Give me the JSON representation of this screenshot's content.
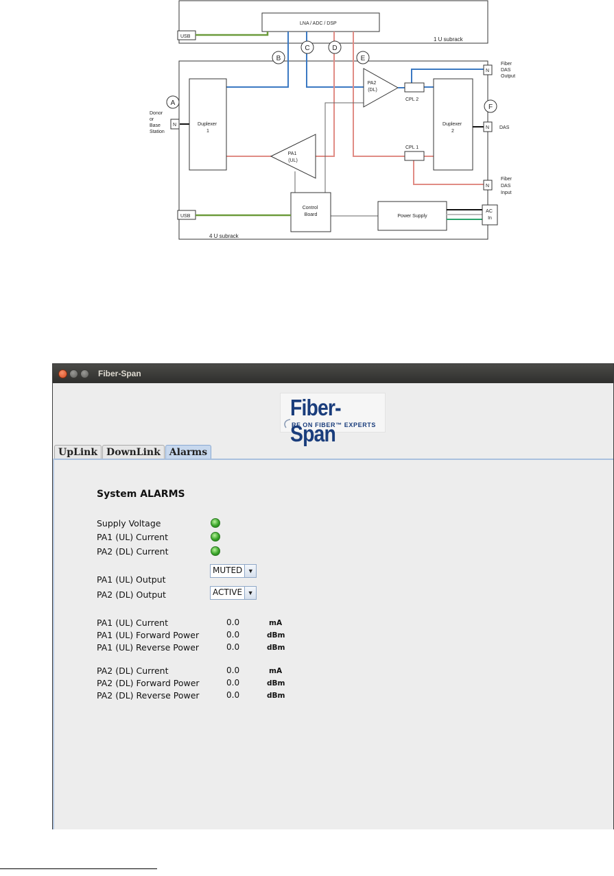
{
  "diagram": {
    "subrack_1u": "1 U subrack",
    "subrack_4u": "4 U subrack",
    "lna_block": "LNA / ADC / DSP",
    "usb_top": "USB",
    "usb_bottom": "USB",
    "markers": [
      "A",
      "B",
      "C",
      "D",
      "E",
      "F"
    ],
    "donor_label": [
      "Donor",
      "or",
      "Base",
      "Station"
    ],
    "n_connector": "N",
    "duplexer1": [
      "Duplexer",
      "1"
    ],
    "duplexer2": [
      "Duplexer",
      "2"
    ],
    "pa1": [
      "PA1",
      "(UL)"
    ],
    "pa2": [
      "PA2",
      "(DL)"
    ],
    "cpl1": "CPL 1",
    "cpl2": "CPL 2",
    "control_board": [
      "Control",
      "Board"
    ],
    "power_supply": "Power Supply",
    "ac_in": [
      "AC",
      "In"
    ],
    "fiber_das_output": [
      "Fiber",
      "DAS",
      "Output"
    ],
    "das": "DAS",
    "fiber_das_input": [
      "Fiber",
      "DAS",
      "Input"
    ],
    "colors": {
      "blue": "#3a78c2",
      "red": "#e08b84",
      "green": "#6b9a3a",
      "black": "#111111"
    }
  },
  "window": {
    "title": "Fiber-Span",
    "logo": {
      "main": "Fiber-Span",
      "tagline": "RF ON FIBER™ EXPERTS"
    },
    "tabs": [
      "UpLink",
      "DownLink",
      "Alarms"
    ],
    "active_tab": "Alarms",
    "heading": "System ALARMS",
    "indicators": [
      {
        "label": "Supply Voltage",
        "status": "ok"
      },
      {
        "label": "PA1 (UL) Current",
        "status": "ok"
      },
      {
        "label": "PA2 (DL) Current",
        "status": "ok"
      }
    ],
    "outputs": [
      {
        "label": "PA1 (UL) Output",
        "value": "MUTED"
      },
      {
        "label": "PA2 (DL) Output",
        "value": "ACTIVE"
      }
    ],
    "measurements_pa1": [
      {
        "label": "PA1 (UL) Current",
        "value": "0.0",
        "unit": "mA"
      },
      {
        "label": "PA1 (UL) Forward Power",
        "value": "0.0",
        "unit": "dBm"
      },
      {
        "label": "PA1 (UL) Reverse Power",
        "value": "0.0",
        "unit": "dBm"
      }
    ],
    "measurements_pa2": [
      {
        "label": "PA2 (DL) Current",
        "value": "0.0",
        "unit": "mA"
      },
      {
        "label": "PA2 (DL) Forward Power",
        "value": "0.0",
        "unit": "dBm"
      },
      {
        "label": "PA2 (DL) Reverse Power",
        "value": "0.0",
        "unit": "dBm"
      }
    ],
    "led_color": "#3aa52a"
  }
}
